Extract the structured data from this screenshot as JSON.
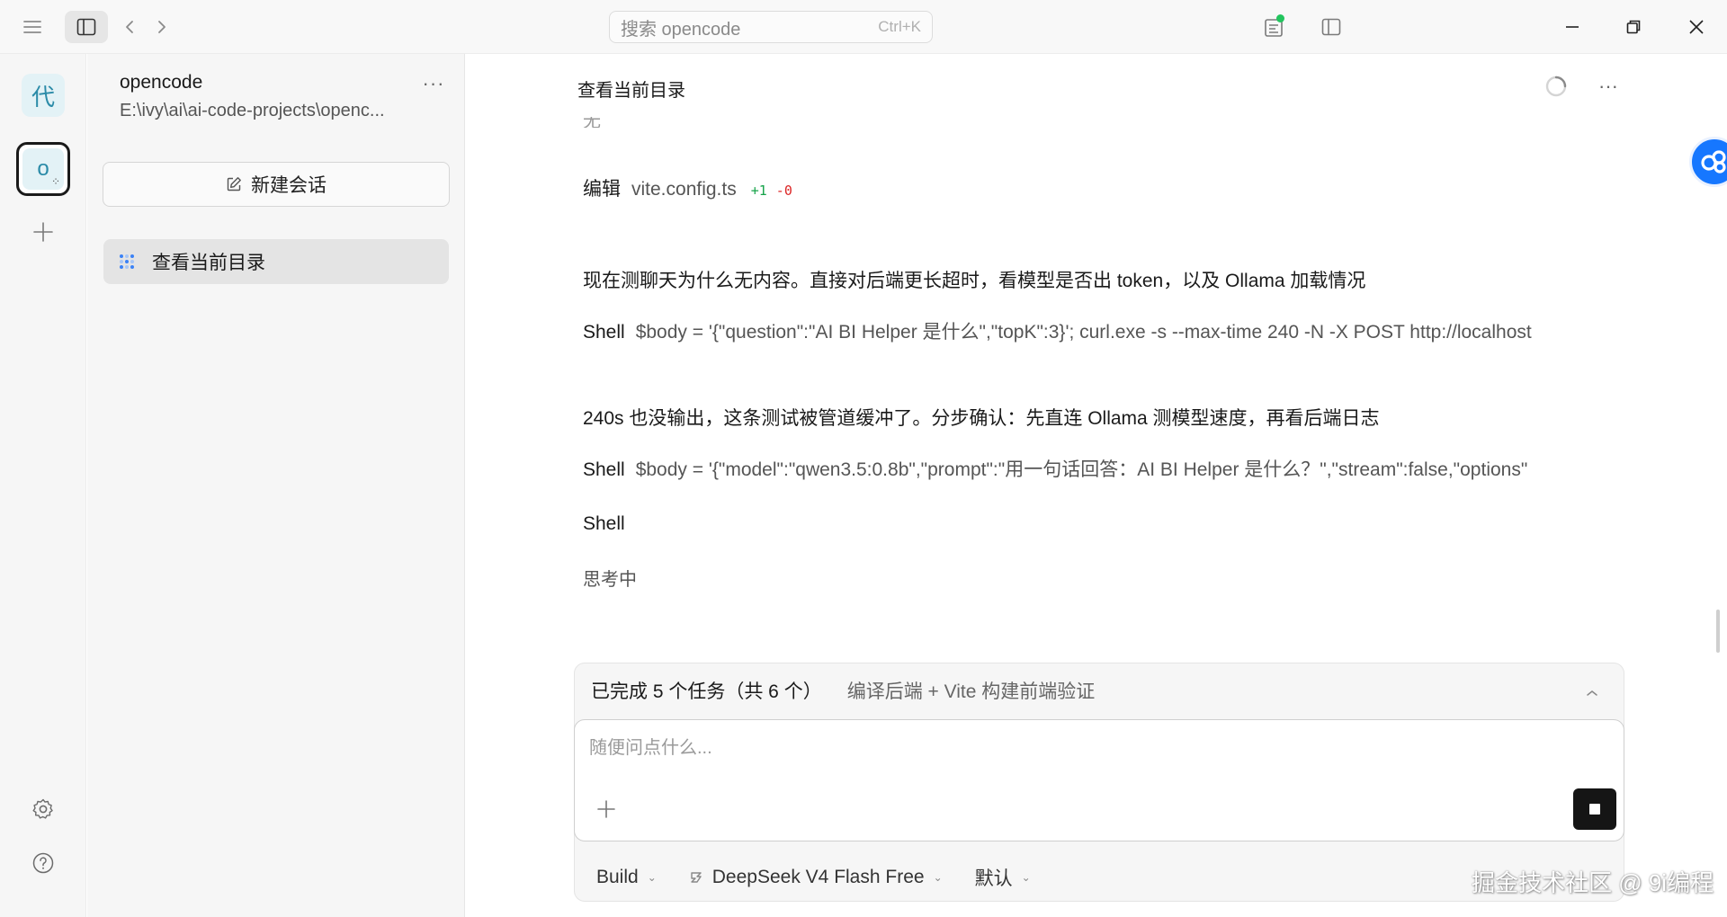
{
  "titlebar": {
    "search_placeholder": "搜索 opencode",
    "search_shortcut": "Ctrl+K"
  },
  "rail": {
    "project_1_initial": "代",
    "project_2_initial": "o"
  },
  "sidebar": {
    "project_name": "opencode",
    "project_path": "E:\\ivy\\ai\\ai-code-projects\\openc...",
    "more": "···",
    "new_session_label": "新建会话",
    "sessions": [
      {
        "title": "查看当前目录"
      }
    ]
  },
  "main": {
    "session_title": "查看当前目录",
    "more": "···",
    "cut_text": "无",
    "transcript": {
      "edit": {
        "label": "编辑",
        "file": "vite.config.ts",
        "added": "+1",
        "removed": "-0"
      },
      "msg_1": "现在测聊天为什么无内容。直接对后端更长超时，看模型是否出 token，以及 Ollama 加载情况",
      "shell_1": {
        "label": "Shell",
        "command": "$body = '{\"question\":\"AI BI Helper 是什么\",\"topK\":3}'; curl.exe -s --max-time 240 -N -X POST http://localhost"
      },
      "msg_2": "240s 也没输出，这条测试被管道缓冲了。分步确认：先直连 Ollama 测模型速度，再看后端日志",
      "shell_2": {
        "label": "Shell",
        "command": "$body = '{\"model\":\"qwen3.5:0.8b\",\"prompt\":\"用一句话回答：AI BI Helper 是什么？\",\"stream\":false,\"options\""
      },
      "shell_3": {
        "label": "Shell"
      },
      "thinking": "思考中"
    }
  },
  "composer": {
    "task_status": "已完成 5 个任务（共 6 个）",
    "task_current": "编译后端 + Vite 构建前端验证",
    "placeholder": "随便问点什么...",
    "agent": "Build",
    "model": "DeepSeek V4 Flash Free",
    "variant": "默认"
  },
  "watermark": "掘金技术社区 @ 9i编程",
  "colors": {
    "accent": "#1677ff",
    "diff_add": "#16a34a",
    "diff_del": "#dc2626",
    "status_dot": "#22c55e"
  }
}
